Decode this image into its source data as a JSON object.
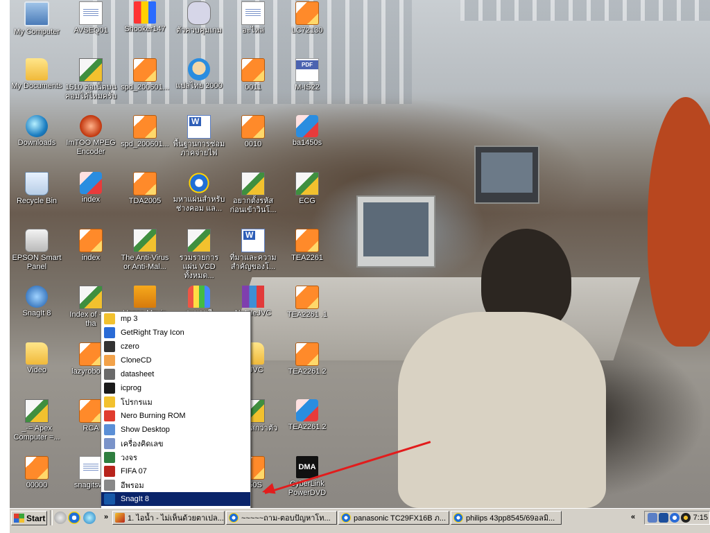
{
  "desktop": {
    "icons": [
      {
        "label": "My Computer",
        "icon": "my-computer-icon",
        "glyph": "g-computer"
      },
      {
        "label": "My Documents",
        "icon": "my-documents-icon",
        "glyph": "g-folder"
      },
      {
        "label": "Downloads",
        "icon": "globe-icon",
        "glyph": "g-globe"
      },
      {
        "label": "Recycle Bin",
        "icon": "recycle-bin-icon",
        "glyph": "g-recycle"
      },
      {
        "label": "EPSON Smart Panel",
        "icon": "scanner-icon",
        "glyph": "g-scanner"
      },
      {
        "label": "SnagIt 8",
        "icon": "snagit-icon",
        "glyph": "g-snagit"
      },
      {
        "label": "Video",
        "icon": "folder-icon",
        "glyph": "g-folder"
      },
      {
        "label": "_-= Apex Computer =...",
        "icon": "installer-icon",
        "glyph": "g-exe"
      },
      {
        "label": "00000",
        "icon": "media-file-icon",
        "glyph": "g-media"
      },
      {
        "label": "AVSEQ01",
        "icon": "video-file-icon",
        "glyph": "g-doc"
      },
      {
        "label": "1510 ต่อเน็ตบนคอมได้ไหมครับ",
        "icon": "installer-icon",
        "glyph": "g-exe"
      },
      {
        "label": "ImTOO MPEG Encoder",
        "icon": "mpeg-encoder-icon",
        "glyph": "g-mpeg"
      },
      {
        "label": "index",
        "icon": "image-file-icon",
        "glyph": "g-cube"
      },
      {
        "label": "index",
        "icon": "media-file-icon",
        "glyph": "g-media"
      },
      {
        "label": "Index of -ps-tha",
        "icon": "installer-icon",
        "glyph": "g-exe"
      },
      {
        "label": "lazyrobot-A",
        "icon": "media-file-icon",
        "glyph": "g-media"
      },
      {
        "label": "RCA",
        "icon": "media-file-icon",
        "glyph": "g-media"
      },
      {
        "label": "snagitsws",
        "icon": "document-icon",
        "glyph": "g-doc"
      },
      {
        "label": "Shooker147",
        "icon": "shooker-icon",
        "glyph": "g-shooker"
      },
      {
        "label": "spd_200601...",
        "icon": "media-file-icon",
        "glyph": "g-media"
      },
      {
        "label": "spd_200601...",
        "icon": "media-file-icon",
        "glyph": "g-media"
      },
      {
        "label": "TDA2005",
        "icon": "media-file-icon",
        "glyph": "g-media"
      },
      {
        "label": "The Anti-Virus or Anti-Mal...",
        "icon": "installer-icon",
        "glyph": "g-exe"
      },
      {
        "label": "Vegas Movie",
        "icon": "clapper-icon",
        "glyph": "g-clapper"
      },
      {
        "label": "ตัวควบคุมเกม",
        "icon": "gamepad-icon",
        "glyph": "g-gamepad"
      },
      {
        "label": "แปลไทย 2000",
        "icon": "translator-icon",
        "glyph": "g-face"
      },
      {
        "label": "พื้นฐานการซ่อมภาคจ่ายไฟ",
        "icon": "word-document-icon",
        "glyph": "g-word"
      },
      {
        "label": "มหาแผ่นสำหรับช่างคอม แล...",
        "icon": "internet-explorer-icon",
        "glyph": "g-ie"
      },
      {
        "label": "รวมรายการแผ่น VCD ทั้งหมด...",
        "icon": "installer-icon",
        "glyph": "g-exe"
      },
      {
        "label": "ระบายสี",
        "icon": "paint-icon",
        "glyph": "g-pencils"
      },
      {
        "label": "อะไหล่",
        "icon": "document-icon",
        "glyph": "g-doc"
      },
      {
        "label": "0011",
        "icon": "media-file-icon",
        "glyph": "g-media"
      },
      {
        "label": "0010",
        "icon": "media-file-icon",
        "glyph": "g-media"
      },
      {
        "label": "อยากตั้งรหัสก่อนเข้าวินโ...",
        "icon": "installer-icon",
        "glyph": "g-exe"
      },
      {
        "label": "ที่มาและความสำคัญของโ...",
        "icon": "word-document-icon",
        "glyph": "g-word"
      },
      {
        "label": "NoFileJVC",
        "icon": "winrar-icon",
        "glyph": "g-rar"
      },
      {
        "label": "leJVC",
        "icon": "folder-icon",
        "glyph": "g-folder"
      },
      {
        "label": "ทำไวรัสกว่าตัว",
        "icon": "installer-icon",
        "glyph": "g-exe"
      },
      {
        "label": "450S",
        "icon": "media-file-icon",
        "glyph": "g-media"
      },
      {
        "label": "LC72130",
        "icon": "media-file-icon",
        "glyph": "g-media"
      },
      {
        "label": "M-IS22",
        "icon": "pdf-icon",
        "glyph": "g-pdf"
      },
      {
        "label": "ba1450s",
        "icon": "image-file-icon",
        "glyph": "g-cube"
      },
      {
        "label": "ECG",
        "icon": "installer-icon",
        "glyph": "g-exe"
      },
      {
        "label": "TEA2261",
        "icon": "media-file-icon",
        "glyph": "g-media"
      },
      {
        "label": "TEA2261 .1",
        "icon": "media-file-icon",
        "glyph": "g-media"
      },
      {
        "label": "TEA2261.2",
        "icon": "media-file-icon",
        "glyph": "g-media"
      },
      {
        "label": "TEA2261.2",
        "icon": "image-file-icon",
        "glyph": "g-cube"
      },
      {
        "label": "CyberLink PowerDVD",
        "icon": "powerdvd-icon",
        "glyph": "g-dma",
        "glyph_text": "DMA"
      }
    ]
  },
  "menu": {
    "items": [
      {
        "label": "mp 3",
        "icon": "star-icon",
        "color": "#f2c12e"
      },
      {
        "label": "GetRight Tray Icon",
        "icon": "getright-icon",
        "color": "#2a6bd6"
      },
      {
        "label": "czero",
        "icon": "czero-icon",
        "color": "#333333"
      },
      {
        "label": "CloneCD",
        "icon": "clonecd-icon",
        "color": "#f2a24a"
      },
      {
        "label": "datasheet",
        "icon": "datasheet-icon",
        "color": "#6a6a6a"
      },
      {
        "label": "icprog",
        "icon": "chip-icon",
        "color": "#1a1a1a"
      },
      {
        "label": "โปรกรแม",
        "icon": "hand-icon",
        "color": "#f2c12e"
      },
      {
        "label": "Nero Burning ROM",
        "icon": "nero-icon",
        "color": "#e03c2e"
      },
      {
        "label": "Show Desktop",
        "icon": "show-desktop-icon",
        "color": "#5b8fd6"
      },
      {
        "label": "เครื่องคิดเลข",
        "icon": "calculator-icon",
        "color": "#7a93c9"
      },
      {
        "label": "วงจร",
        "icon": "circuit-icon",
        "color": "#2f7f3f"
      },
      {
        "label": "FIFA 07",
        "icon": "fifa-icon",
        "color": "#b8241c"
      },
      {
        "label": "อีพรอม",
        "icon": "eprom-icon",
        "color": "#888888"
      },
      {
        "label": "SnagIt 8",
        "icon": "snagit-icon",
        "color": "#1758a8"
      }
    ],
    "active_index": 13
  },
  "taskbar": {
    "start_label": "Start",
    "tasks": [
      {
        "label": "1. ไอน้ำ - ไม่เห็นด้วยตาเปล...",
        "icon": "pencil-icon"
      },
      {
        "label": "~~~~~ถาม-ตอบปัญหาโท...",
        "icon": "internet-explorer-icon"
      },
      {
        "label": "panasonic TC29FX16B ภ...",
        "icon": "internet-explorer-icon"
      },
      {
        "label": "philips 43pp8545/69อลมิ...",
        "icon": "internet-explorer-icon"
      }
    ],
    "chevron": "»",
    "tray_chevron": "«",
    "clock": "7:15"
  },
  "colors": {
    "menu_highlight": "#0a246a",
    "annotation_arrow": "#e21c1c",
    "taskbar": "#d4d0c8"
  }
}
